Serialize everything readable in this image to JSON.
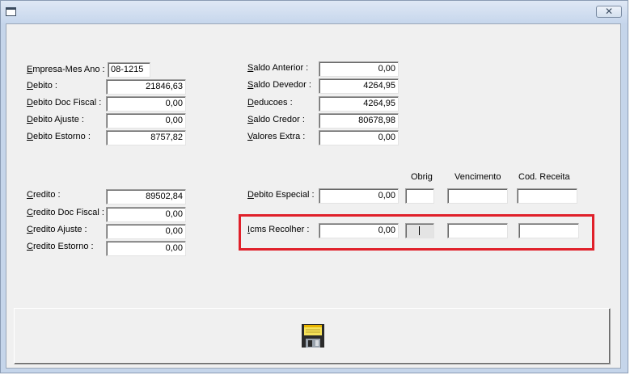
{
  "left_top": [
    {
      "label_u": "E",
      "label_rest": "mpresa-Mes Ano :",
      "value": "08-1215"
    },
    {
      "label_u": "D",
      "label_rest": "ebito :",
      "value": "21846,63"
    },
    {
      "label_u": "D",
      "label_rest": "ebito Doc Fiscal :",
      "value": "0,00"
    },
    {
      "label_u": "D",
      "label_rest": "ebito Ajuste :",
      "value": "0,00"
    },
    {
      "label_u": "D",
      "label_rest": "ebito Estorno :",
      "value": "8757,82"
    }
  ],
  "right_top": [
    {
      "label_u": "S",
      "label_rest": "aldo Anterior :",
      "value": "0,00"
    },
    {
      "label_u": "S",
      "label_rest": "aldo Devedor :",
      "value": "4264,95"
    },
    {
      "label_u": "D",
      "label_rest": "educoes :",
      "value": "4264,95"
    },
    {
      "label_u": "S",
      "label_rest": "aldo Credor :",
      "value": "80678,98"
    },
    {
      "label_u": "V",
      "label_rest": "alores Extra :",
      "value": "0,00"
    }
  ],
  "left_bottom": [
    {
      "label_u": "C",
      "label_rest": "redito :",
      "value": "89502,84"
    },
    {
      "label_u": "C",
      "label_rest": "redito Doc Fiscal :",
      "value": "0,00"
    },
    {
      "label_u": "C",
      "label_rest": "redito Ajuste :",
      "value": "0,00"
    },
    {
      "label_u": "C",
      "label_rest": "redito Estorno :",
      "value": "0,00"
    }
  ],
  "headers": {
    "obrig": "Obrig",
    "vencimento": "Vencimento",
    "cod_receita": "Cod. Receita"
  },
  "debito_especial": {
    "label_u": "D",
    "label_rest": "ebito Especial :",
    "value": "0,00",
    "obrig": "",
    "vencimento": "",
    "cod_receita": ""
  },
  "icms_recolher": {
    "label_u": "I",
    "label_rest": "cms Recolher :",
    "value": "0,00",
    "obrig": "",
    "vencimento": "",
    "cod_receita": ""
  },
  "toolbar": {
    "save_icon": "floppy-disk-icon"
  },
  "colors": {
    "highlight": "#e0202a",
    "window_bg": "#f0f0f0",
    "titlebar": "#c6d6ec"
  }
}
